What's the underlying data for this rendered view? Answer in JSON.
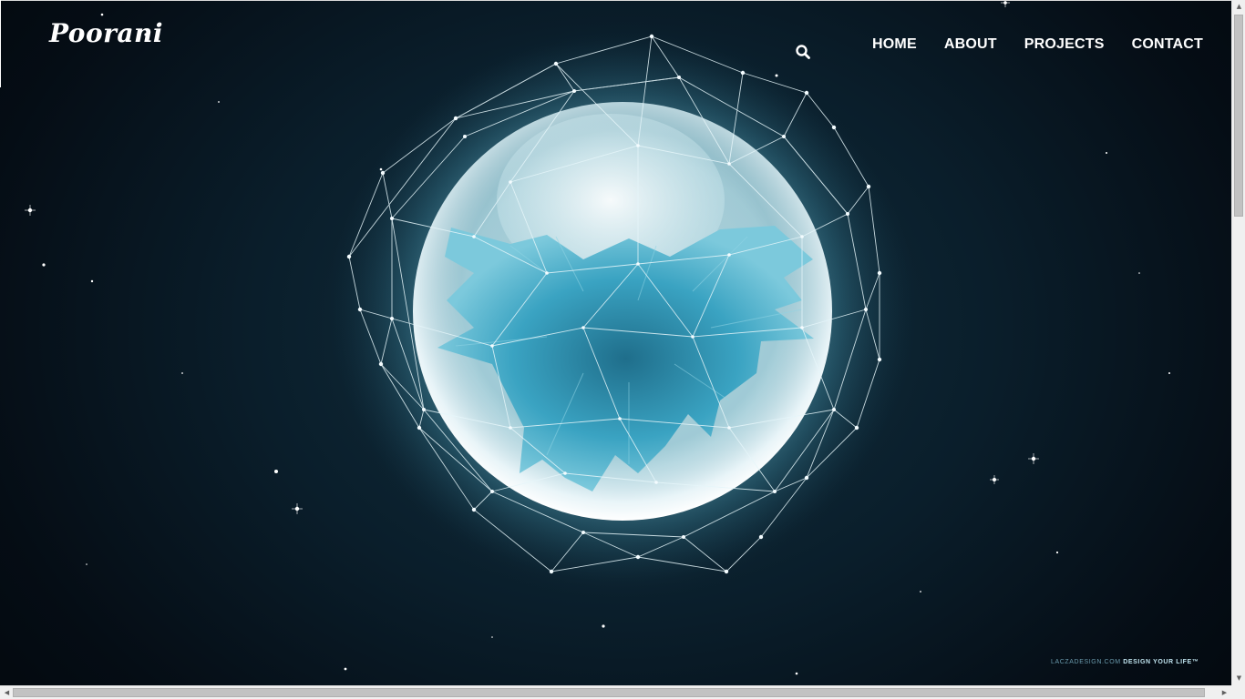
{
  "site": {
    "logo_text": "Poorani"
  },
  "nav": {
    "search_icon": "search-icon",
    "items": [
      {
        "label": "HOME"
      },
      {
        "label": "ABOUT"
      },
      {
        "label": "PROJECTS"
      },
      {
        "label": "CONTACT"
      }
    ]
  },
  "hero": {
    "credit_site": "LACZADESIGN.COM",
    "credit_tagline": "DESIGN YOUR LIFE™"
  },
  "scrollbars": {
    "up_arrow": "▲",
    "down_arrow": "▼",
    "left_arrow": "◀",
    "right_arrow": "▶"
  },
  "colors": {
    "nav_text": "#ffffff",
    "orb_glow": "#cdeef5",
    "crystal": "#3a9ab8",
    "background": "#06121c"
  }
}
